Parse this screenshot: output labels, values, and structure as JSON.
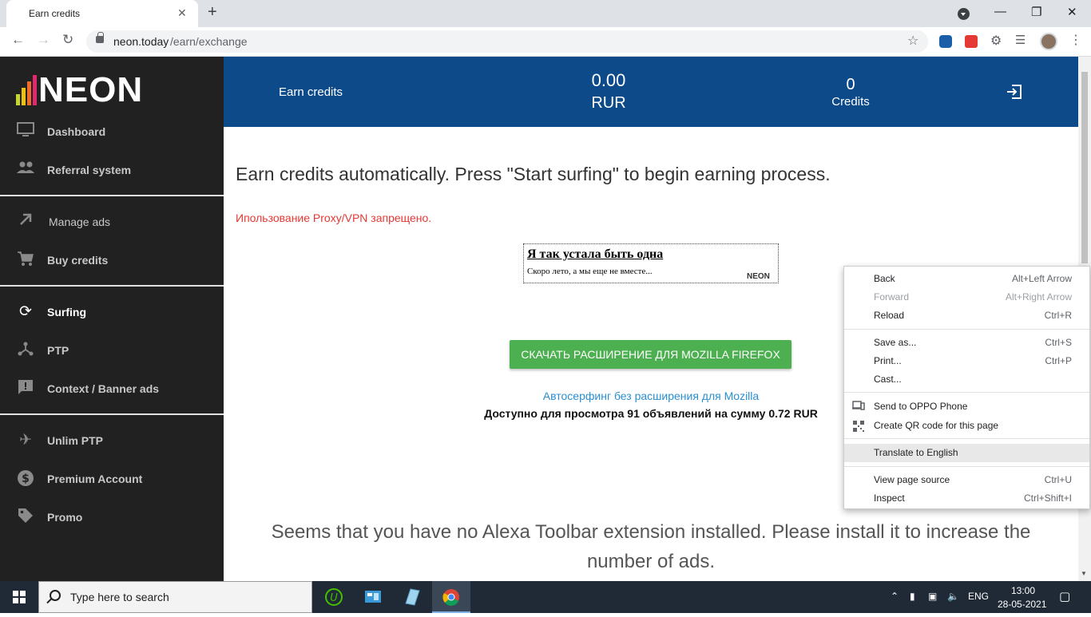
{
  "browser": {
    "tab_title": "Earn credits",
    "tab_close": "✕",
    "new_tab": "+",
    "url_host": "neon.today",
    "url_path": "/earn/exchange",
    "window_min": "—",
    "window_max": "❐",
    "window_close": "✕"
  },
  "sidebar": {
    "logo_text": "NEON",
    "items": [
      {
        "label": "Dashboard",
        "icon": "monitor-icon"
      },
      {
        "label": "Referral system",
        "icon": "people-icon"
      },
      {
        "label": "Manage ads",
        "icon": "arrow-up-right-icon"
      },
      {
        "label": "Buy credits",
        "icon": "cart-icon"
      },
      {
        "label": "Surfing",
        "icon": "refresh-icon"
      },
      {
        "label": "PTP",
        "icon": "share-icon"
      },
      {
        "label": "Context / Banner ads",
        "icon": "alert-message-icon"
      },
      {
        "label": "Unlim PTP",
        "icon": "airplane-icon"
      },
      {
        "label": "Premium Account",
        "icon": "dollar-icon"
      },
      {
        "label": "Promo",
        "icon": "tag-icon"
      }
    ]
  },
  "header": {
    "title": "Earn credits",
    "balance": "0.00",
    "currency": "RUR",
    "credits": "0",
    "credits_label": "Credits"
  },
  "main": {
    "heading": "Earn credits automatically. Press \"Start surfing\" to begin earning process.",
    "warning": "Ипользование Proxy/VPN запрещено.",
    "ad_title": "Я так устала быть одна",
    "ad_desc": "Скоро лето, а мы еще не вместе...",
    "ad_logo": "NEON",
    "firefox_button": "СКАЧАТЬ РАСШИРЕНИЕ ДЛЯ MOZILLA FIREFOX",
    "auto_link": "Автосерфинг без расширения для Mozilla",
    "available": "Доступно для просмотра 91 объявлений на сумму 0.72 RUR",
    "alexa_msg": "Seems that you have no Alexa Toolbar extension installed. Please install it to increase the number of ads."
  },
  "context_menu": {
    "back": {
      "label": "Back",
      "shortcut": "Alt+Left Arrow"
    },
    "forward": {
      "label": "Forward",
      "shortcut": "Alt+Right Arrow"
    },
    "reload": {
      "label": "Reload",
      "shortcut": "Ctrl+R"
    },
    "save_as": {
      "label": "Save as...",
      "shortcut": "Ctrl+S"
    },
    "print": {
      "label": "Print...",
      "shortcut": "Ctrl+P"
    },
    "cast": {
      "label": "Cast...",
      "shortcut": ""
    },
    "send_phone": {
      "label": "Send to OPPO Phone",
      "shortcut": ""
    },
    "qr": {
      "label": "Create QR code for this page",
      "shortcut": ""
    },
    "translate": {
      "label": "Translate to English",
      "shortcut": ""
    },
    "view_source": {
      "label": "View page source",
      "shortcut": "Ctrl+U"
    },
    "inspect": {
      "label": "Inspect",
      "shortcut": "Ctrl+Shift+I"
    }
  },
  "taskbar": {
    "search_placeholder": "Type here to search",
    "language": "ENG",
    "time": "13:00",
    "date": "28-05-2021"
  },
  "colors": {
    "header_bg": "#0d4a8a",
    "sidebar_bg": "#212121",
    "button_green": "#4caf50",
    "warning_red": "#e53935",
    "link_blue": "#2a8fd1"
  }
}
